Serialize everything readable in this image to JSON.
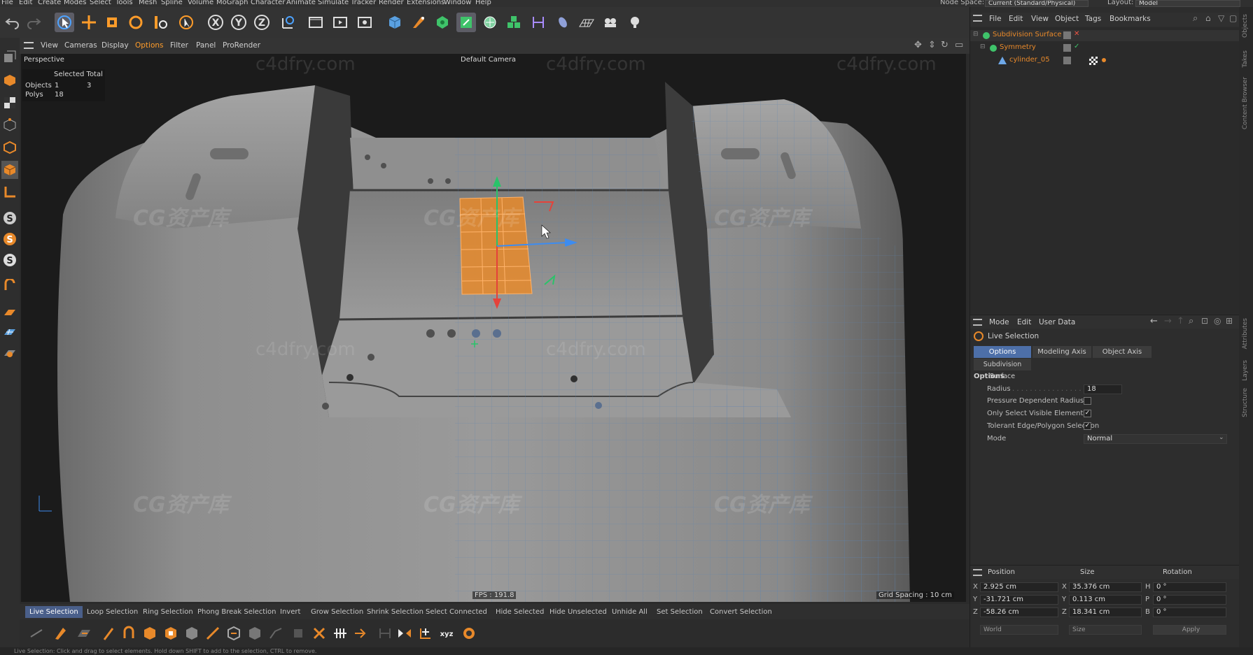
{
  "menu": {
    "items": [
      "File",
      "Edit",
      "Create",
      "Modes",
      "Select",
      "Tools",
      "Mesh",
      "Spline",
      "Volume",
      "MoGraph",
      "Character",
      "Animate",
      "Simulate",
      "Tracker",
      "Render",
      "Extensions",
      "Window",
      "Help"
    ],
    "node_space_label": "Node Space:",
    "node_space_value": "Current (Standard/Physical)",
    "layout_label": "Layout:",
    "layout_value": "Model"
  },
  "toolbar": {
    "icons": [
      "undo-icon",
      "redo-icon",
      "select-arrow-icon",
      "move-icon",
      "scale-icon",
      "rotate-icon",
      "recent-tools-icon",
      "live-selection-icon",
      "x-axis-icon",
      "y-axis-icon",
      "z-axis-icon",
      "coordinate-system-icon",
      "render-view-icon",
      "render-picture-viewer-icon",
      "render-settings-icon",
      "cube-icon",
      "pen-icon",
      "subdivision-icon",
      "array-icon",
      "deformer-icon",
      "mograph-cloner-icon",
      "measure-icon",
      "camera-icon",
      "floor-icon",
      "scene-icon",
      "light-icon"
    ],
    "axis_labels": [
      "X",
      "Y",
      "Z"
    ]
  },
  "viewport_menu": {
    "items": [
      "View",
      "Cameras",
      "Display",
      "Options",
      "Filter",
      "Panel",
      "ProRender"
    ]
  },
  "viewport": {
    "view_name": "Perspective",
    "camera_label": "Default Camera",
    "stats_header": "Selected Total",
    "stats": [
      {
        "label": "Objects",
        "selected": "1",
        "total": "3"
      },
      {
        "label": "Polys",
        "selected": "18",
        "total": ""
      }
    ],
    "fps": "FPS : 191.8",
    "grid_spacing": "Grid Spacing : 10 cm",
    "watermark_url": "c4dfry.com",
    "watermark_cg": "CG资产库"
  },
  "selection_bar": {
    "buttons": [
      "Live Selection",
      "Loop Selection",
      "Ring Selection",
      "Phong Break Selection",
      "Invert",
      "Grow Selection",
      "Shrink Selection",
      "Select Connected",
      "Hide Selected",
      "Hide Unselected",
      "Unhide All",
      "Set Selection",
      "Convert Selection"
    ],
    "active": "Live Selection"
  },
  "status_text": "Live Selection: Click and drag to select elements. Hold down SHIFT to add to the selection, CTRL to remove.",
  "object_manager": {
    "menu": [
      "File",
      "Edit",
      "View",
      "Object",
      "Tags",
      "Bookmarks"
    ],
    "objects": [
      {
        "name": "Subdivision Surface",
        "color": "#e8892a"
      },
      {
        "name": "Symmetry",
        "color": "#e8892a"
      },
      {
        "name": "cylinder_05",
        "color": "#e8892a"
      }
    ]
  },
  "attributes": {
    "menu": [
      "Mode",
      "Edit",
      "User Data"
    ],
    "tool_name": "Live Selection",
    "tabs": [
      "Options",
      "Modeling Axis",
      "Object Axis"
    ],
    "sub_tab": "Subdivision Surface",
    "section": "Options",
    "fields": {
      "radius_label": "Radius",
      "radius_value": "18",
      "pressure_label": "Pressure Dependent Radius",
      "visible_label": "Only Select Visible Elements",
      "tolerant_label": "Tolerant Edge/Polygon Selection",
      "mode_label": "Mode",
      "mode_value": "Normal"
    },
    "checks": {
      "pressure": false,
      "visible": true,
      "tolerant": true
    }
  },
  "coordinates": {
    "headers": [
      "Position",
      "Size",
      "Rotation"
    ],
    "rows": [
      {
        "axis": "X",
        "position": "2.925 cm",
        "size_axis": "X",
        "size": "35.376 cm",
        "rot_axis": "H",
        "rotation": "0 °"
      },
      {
        "axis": "Y",
        "position": "-31.721 cm",
        "size_axis": "Y",
        "size": "0.113 cm",
        "rot_axis": "P",
        "rotation": "0 °"
      },
      {
        "axis": "Z",
        "position": "-58.26 cm",
        "size_axis": "Z",
        "size": "18.341 cm",
        "rot_axis": "B",
        "rotation": "0 °"
      }
    ],
    "footer": [
      "World",
      "Size",
      "Apply"
    ]
  },
  "side_tabs": [
    "Objects",
    "Takes",
    "Content Browser",
    "Attributes",
    "Layers",
    "Structure"
  ],
  "colors": {
    "accent": "#4d6fa8",
    "selection": "#e8892a"
  }
}
